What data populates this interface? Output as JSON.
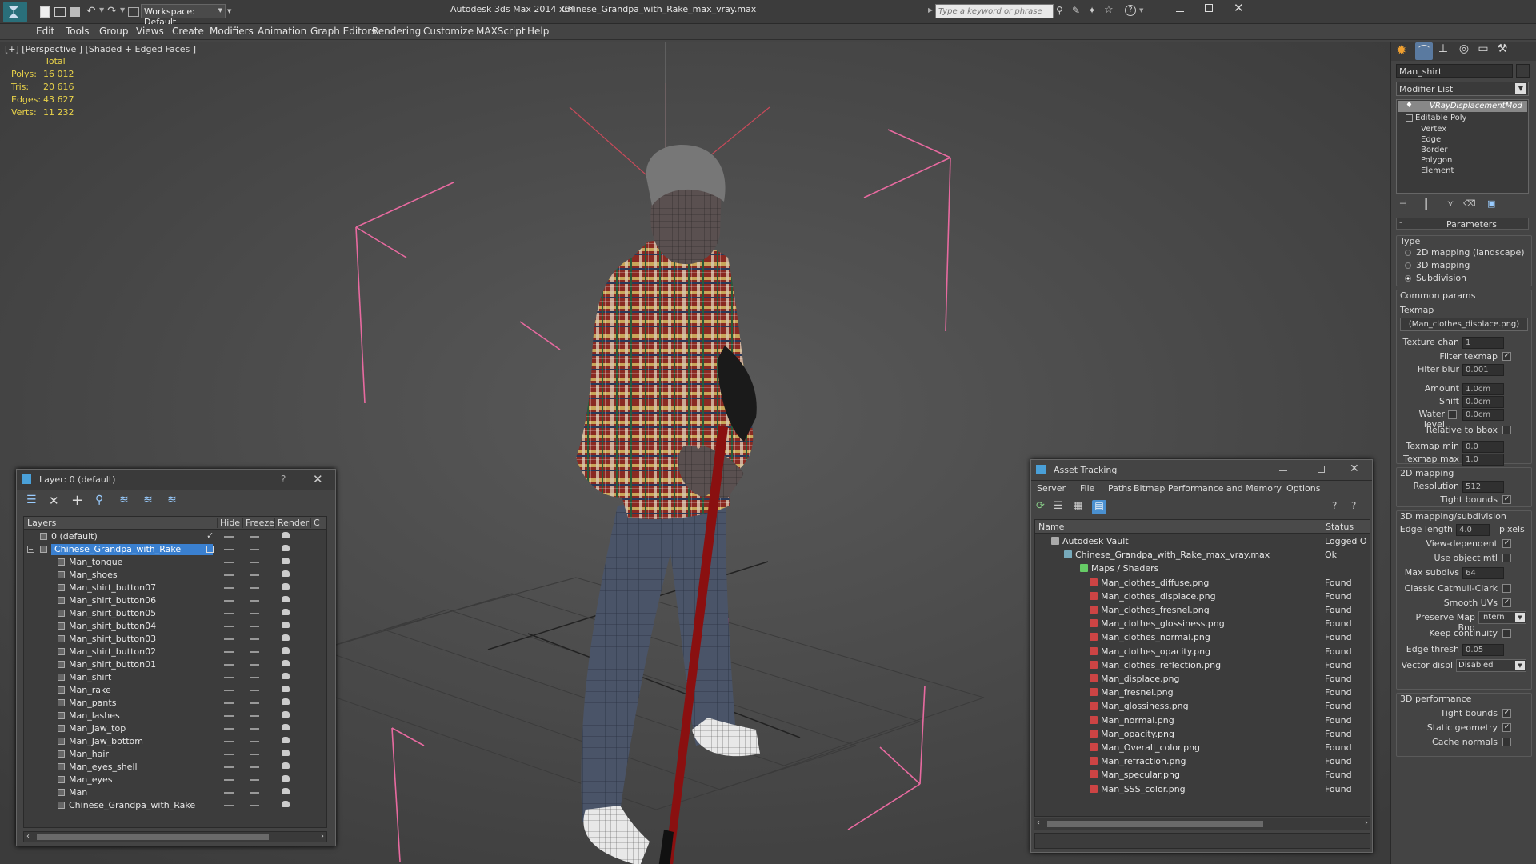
{
  "app": {
    "title": "Autodesk 3ds Max  2014 x64",
    "filename": "Chinese_Grandpa_with_Rake_max_vray.max",
    "workspace": "Workspace: Default",
    "search_placeholder": "Type a keyword or phrase"
  },
  "menu": [
    "Edit",
    "Tools",
    "Group",
    "Views",
    "Create",
    "Modifiers",
    "Animation",
    "Graph Editors",
    "Rendering",
    "Customize",
    "MAXScript",
    "Help"
  ],
  "viewport": {
    "label": "[+] [Perspective ] [Shaded + Edged Faces ]",
    "stats": {
      "header": "Total",
      "polys_label": "Polys:",
      "polys": "16 012",
      "tris_label": "Tris:",
      "tris": "20 616",
      "edges_label": "Edges:",
      "edges": "43 627",
      "verts_label": "Verts:",
      "verts": "11 232"
    }
  },
  "layer_window": {
    "title": "Layer: 0 (default)",
    "help": "?",
    "columns": [
      "Layers",
      "Hide",
      "Freeze",
      "Render",
      "C"
    ],
    "rows": [
      {
        "name": "0 (default)",
        "level": 0
      },
      {
        "name": "Chinese_Grandpa_with_Rake",
        "level": 0,
        "selected": true
      },
      {
        "name": "Man_tongue",
        "level": 1
      },
      {
        "name": "Man_shoes",
        "level": 1
      },
      {
        "name": "Man_shirt_button07",
        "level": 1
      },
      {
        "name": "Man_shirt_button06",
        "level": 1
      },
      {
        "name": "Man_shirt_button05",
        "level": 1
      },
      {
        "name": "Man_shirt_button04",
        "level": 1
      },
      {
        "name": "Man_shirt_button03",
        "level": 1
      },
      {
        "name": "Man_shirt_button02",
        "level": 1
      },
      {
        "name": "Man_shirt_button01",
        "level": 1
      },
      {
        "name": "Man_shirt",
        "level": 1
      },
      {
        "name": "Man_rake",
        "level": 1
      },
      {
        "name": "Man_pants",
        "level": 1
      },
      {
        "name": "Man_lashes",
        "level": 1
      },
      {
        "name": "Man_Jaw_top",
        "level": 1
      },
      {
        "name": "Man_Jaw_bottom",
        "level": 1
      },
      {
        "name": "Man_hair",
        "level": 1
      },
      {
        "name": "Man_eyes_shell",
        "level": 1
      },
      {
        "name": "Man_eyes",
        "level": 1
      },
      {
        "name": "Man",
        "level": 1
      },
      {
        "name": "Chinese_Grandpa_with_Rake",
        "level": 1
      }
    ]
  },
  "asset_window": {
    "title": "Asset Tracking",
    "menu": [
      "Server",
      "File",
      "Paths",
      "Bitmap Performance and Memory",
      "Options"
    ],
    "columns": [
      "Name",
      "Status"
    ],
    "rows": [
      {
        "name": "Autodesk Vault",
        "status": "Logged O",
        "level": 0
      },
      {
        "name": "Chinese_Grandpa_with_Rake_max_vray.max",
        "status": "Ok",
        "level": 1
      },
      {
        "name": "Maps / Shaders",
        "status": "",
        "level": 2
      },
      {
        "name": "Man_clothes_diffuse.png",
        "status": "Found",
        "level": 3
      },
      {
        "name": "Man_clothes_displace.png",
        "status": "Found",
        "level": 3
      },
      {
        "name": "Man_clothes_fresnel.png",
        "status": "Found",
        "level": 3
      },
      {
        "name": "Man_clothes_glossiness.png",
        "status": "Found",
        "level": 3
      },
      {
        "name": "Man_clothes_normal.png",
        "status": "Found",
        "level": 3
      },
      {
        "name": "Man_clothes_opacity.png",
        "status": "Found",
        "level": 3
      },
      {
        "name": "Man_clothes_reflection.png",
        "status": "Found",
        "level": 3
      },
      {
        "name": "Man_displace.png",
        "status": "Found",
        "level": 3
      },
      {
        "name": "Man_fresnel.png",
        "status": "Found",
        "level": 3
      },
      {
        "name": "Man_glossiness.png",
        "status": "Found",
        "level": 3
      },
      {
        "name": "Man_normal.png",
        "status": "Found",
        "level": 3
      },
      {
        "name": "Man_opacity.png",
        "status": "Found",
        "level": 3
      },
      {
        "name": "Man_Overall_color.png",
        "status": "Found",
        "level": 3
      },
      {
        "name": "Man_refraction.png",
        "status": "Found",
        "level": 3
      },
      {
        "name": "Man_specular.png",
        "status": "Found",
        "level": 3
      },
      {
        "name": "Man_SSS_color.png",
        "status": "Found",
        "level": 3
      }
    ]
  },
  "command_panel": {
    "object_name": "Man_shirt",
    "modifier_list": "Modifier List",
    "stack": [
      "VRayDisplacementMod",
      "Editable Poly",
      "Vertex",
      "Edge",
      "Border",
      "Polygon",
      "Element"
    ],
    "rollout_title": "Parameters",
    "type_label": "Type",
    "type_options": [
      "2D mapping (landscape)",
      "3D mapping",
      "Subdivision"
    ],
    "type_selected": "Subdivision",
    "common_label": "Common params",
    "texmap_label": "Texmap",
    "texmap_value": "(Man_clothes_displace.png)",
    "texture_chan_label": "Texture chan",
    "texture_chan": "1",
    "filter_texmap_label": "Filter texmap",
    "filter_blur_label": "Filter blur",
    "filter_blur": "0.001",
    "amount_label": "Amount",
    "amount": "1.0cm",
    "shift_label": "Shift",
    "shift": "0.0cm",
    "water_label": "Water level",
    "water": "0.0cm",
    "relative_bbox_label": "Relative to bbox",
    "texmap_min_label": "Texmap min",
    "texmap_min": "0.0",
    "texmap_max_label": "Texmap max",
    "texmap_max": "1.0",
    "mapping2d_label": "2D mapping",
    "resolution_label": "Resolution",
    "resolution": "512",
    "tight_bounds_label": "Tight bounds",
    "mapping3d_label": "3D mapping/subdivision",
    "edge_length_label": "Edge length",
    "edge_length": "4.0",
    "pixels_label": "pixels",
    "view_dependent_label": "View-dependent",
    "use_object_mtl_label": "Use object mtl",
    "max_subdivs_label": "Max subdivs",
    "max_subdivs": "64",
    "catmull_label": "Classic Catmull-Clark",
    "smooth_uvs_label": "Smooth UVs",
    "preserve_label": "Preserve Map Bnd",
    "preserve_value": "Intern",
    "keep_continuity_label": "Keep continuity",
    "edge_thresh_label": "Edge thresh",
    "edge_thresh": "0.05",
    "vector_disp_label": "Vector displ",
    "vector_disp_value": "Disabled",
    "perf_label": "3D performance",
    "perf_tight_label": "Tight bounds",
    "static_geom_label": "Static geometry",
    "cache_normals_label": "Cache normals"
  }
}
